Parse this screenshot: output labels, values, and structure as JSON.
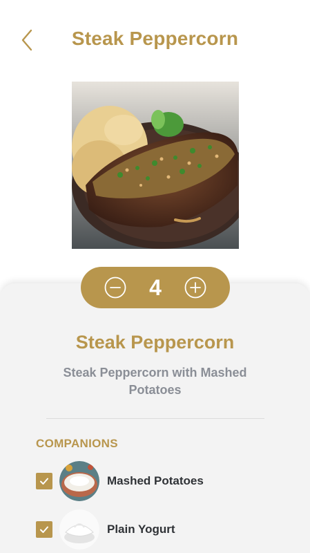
{
  "header": {
    "title": "Steak Peppercorn",
    "back_icon": "chevron-left-icon"
  },
  "dish": {
    "image": "steak-peppercorn-photo",
    "name": "Steak Peppercorn",
    "description": "Steak Peppercorn with Mashed Potatoes"
  },
  "quantity": {
    "value": "4",
    "decrease_icon": "minus-circle-icon",
    "increase_icon": "plus-circle-icon"
  },
  "companions": {
    "title": "COMPANIONS",
    "items": [
      {
        "label": "Mashed Potatoes",
        "checked": true,
        "image": "mashed-potatoes-thumbnail"
      },
      {
        "label": "Plain Yogurt",
        "checked": true,
        "image": "plain-yogurt-thumbnail"
      }
    ]
  },
  "colors": {
    "accent": "#b8964d",
    "panel": "#f3f3f3",
    "description": "#8a8e96",
    "text": "#2f3236"
  }
}
